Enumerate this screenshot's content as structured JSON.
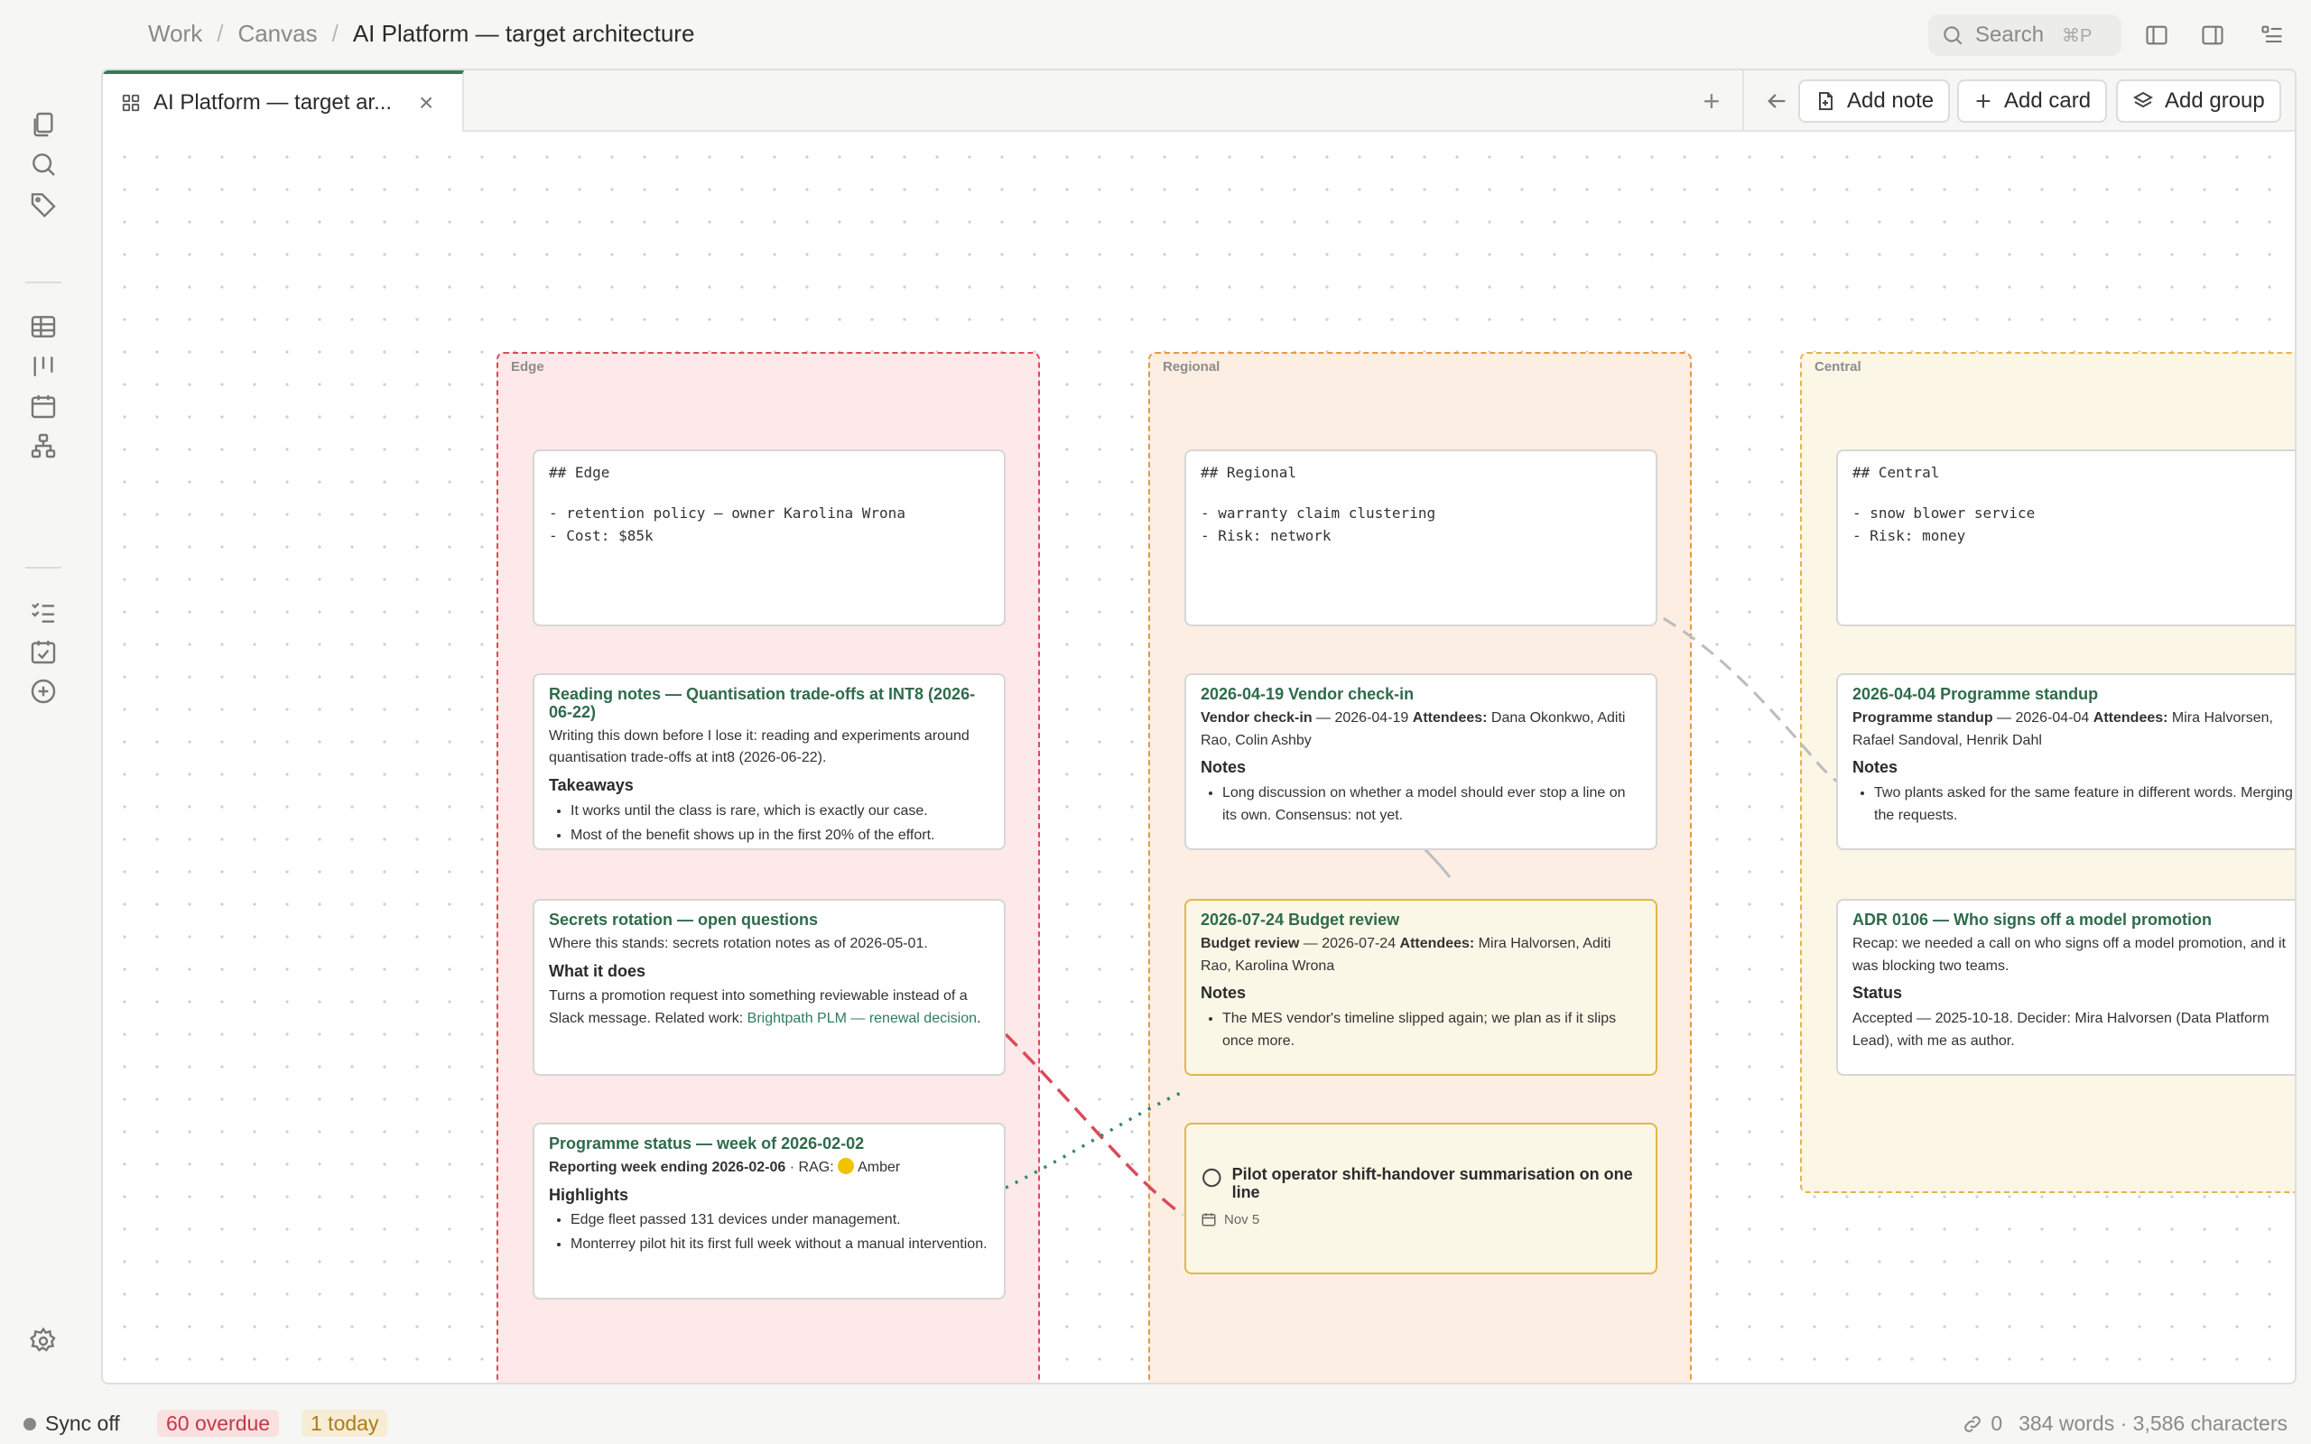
{
  "breadcrumb": {
    "items": [
      "Work",
      "Canvas"
    ],
    "current": "AI Platform — target architecture"
  },
  "search": {
    "label": "Search",
    "shortcut": "⌘P"
  },
  "tab": {
    "title": "AI Platform — target ar...",
    "close": "×"
  },
  "toolbar": {
    "new_tab": "+",
    "add_note": "Add note",
    "add_card": "Add card",
    "add_group": "Add group"
  },
  "groups": {
    "edge": "Edge",
    "regional": "Regional",
    "central": "Central"
  },
  "nodes": {
    "edge_note": {
      "heading": "## Edge",
      "lines": [
        "- retention policy — owner Karolina Wrona",
        "- Cost: $85k"
      ]
    },
    "regional_note": {
      "heading": "## Regional",
      "lines": [
        "- warranty claim clustering",
        "- Risk: network"
      ]
    },
    "central_note": {
      "heading": "## Central",
      "lines": [
        "- snow blower service",
        "- Risk: money"
      ]
    },
    "reading": {
      "title": "Reading notes — Quantisation trade-offs at INT8 (2026-06-22)",
      "body": "Writing this down before I lose it: reading and experiments around quantisation trade-offs at int8 (2026-06-22).",
      "section": "Takeaways",
      "items": [
        "It works until the class is rare, which is exactly our case.",
        "Most of the benefit shows up in the first 20% of the effort."
      ]
    },
    "secrets": {
      "title": "Secrets rotation — open questions",
      "body": "Where this stands: secrets rotation notes as of 2026-05-01.",
      "section": "What it does",
      "text": "Turns a promotion request into something reviewable instead of a Slack message. Related work:",
      "link": "Brightpath PLM — renewal decision"
    },
    "programme": {
      "title": "Programme status — week of 2026-02-02",
      "meta_bold": "Reporting week ending 2026-02-06",
      "meta_rest": " · RAG:",
      "rag": "Amber",
      "section": "Highlights",
      "items": [
        "Edge fleet passed 131 devices under management.",
        "Monterrey pilot hit its first full week without a manual intervention."
      ]
    },
    "vendor": {
      "title": "2026-04-19 Vendor check-in",
      "meta_bold": "Vendor check-in",
      "meta_date": " — 2026-04-19 ",
      "attendees_label": "Attendees:",
      "attendees": " Dana Okonkwo, Aditi Rao, Colin Ashby",
      "section": "Notes",
      "items": [
        "Long discussion on whether a model should ever stop a line on its own. Consensus: not yet."
      ]
    },
    "budget": {
      "title": "2026-07-24 Budget review",
      "meta_bold": "Budget review",
      "meta_date": " — 2026-07-24 ",
      "attendees_label": "Attendees:",
      "attendees": " Mira Halvorsen, Aditi Rao, Karolina Wrona",
      "section": "Notes",
      "items": [
        "The MES vendor's timeline slipped again; we plan as if it slips once more."
      ]
    },
    "task": {
      "title": "Pilot operator shift-handover summarisation on one line",
      "date": "Nov 5"
    },
    "standup": {
      "title": "2026-04-04 Programme standup",
      "meta_bold": "Programme standup",
      "meta_date": " — 2026-04-04 ",
      "attendees_label": "Attendees:",
      "attendees": " Mira Halvorsen, Rafael Sandoval, Henrik Dahl",
      "section": "Notes",
      "items": [
        "Two plants asked for the same feature in different words. Merging the requests."
      ]
    },
    "adr": {
      "title": "ADR 0106 — Who signs off a model promotion",
      "body": "Recap: we needed a call on who signs off a model promotion, and it was blocking two teams.",
      "section": "Status",
      "text": "Accepted — 2025-10-18. Decider: Mira Halvorsen (Data Platform Lead), with me as author."
    }
  },
  "status": {
    "sync": "Sync off",
    "overdue": "60 overdue",
    "today": "1 today",
    "links": "0",
    "counts": "384 words · 3,586 characters"
  },
  "colors": {
    "accent": "#2e7d5b",
    "edge": "#d94b5a",
    "regional": "#e39a3e",
    "central": "#e2b54c"
  }
}
